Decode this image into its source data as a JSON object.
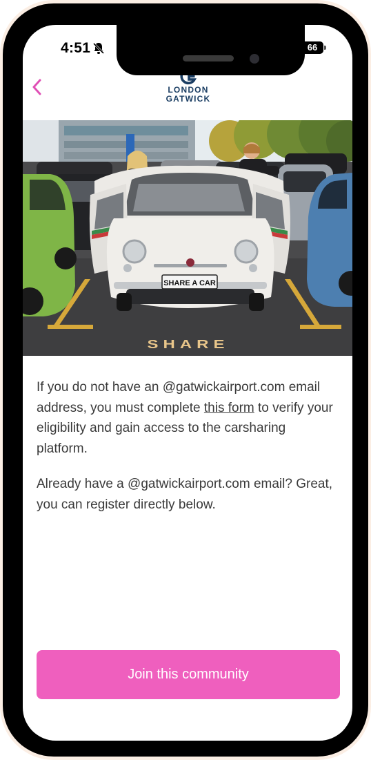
{
  "status_bar": {
    "time": "4:51",
    "battery": "66",
    "icons": [
      "bell-slash-icon",
      "cellular-signal-icon",
      "wifi-icon",
      "battery-icon"
    ]
  },
  "nav": {
    "back_icon": "chevron-left-icon",
    "logo_line1": "LONDON",
    "logo_line2": "GATWICK"
  },
  "hero": {
    "plate_text": "SHARE A CAR",
    "ground_text": "SHARE"
  },
  "content": {
    "para1_before": "If you do not have an @gatwickairport.com email address, you must complete ",
    "para1_link": "this form",
    "para1_after": " to verify your eligibility and gain access to the carsharing platform.",
    "para2": "Already have a @gatwickairport.com email? Great, you can register directly below."
  },
  "cta": {
    "label": "Join this community"
  },
  "colors": {
    "accent": "#ef5fbe",
    "back_chevron": "#e04fb5",
    "logo_navy": "#1b3e63",
    "text": "#3a3a3a"
  }
}
